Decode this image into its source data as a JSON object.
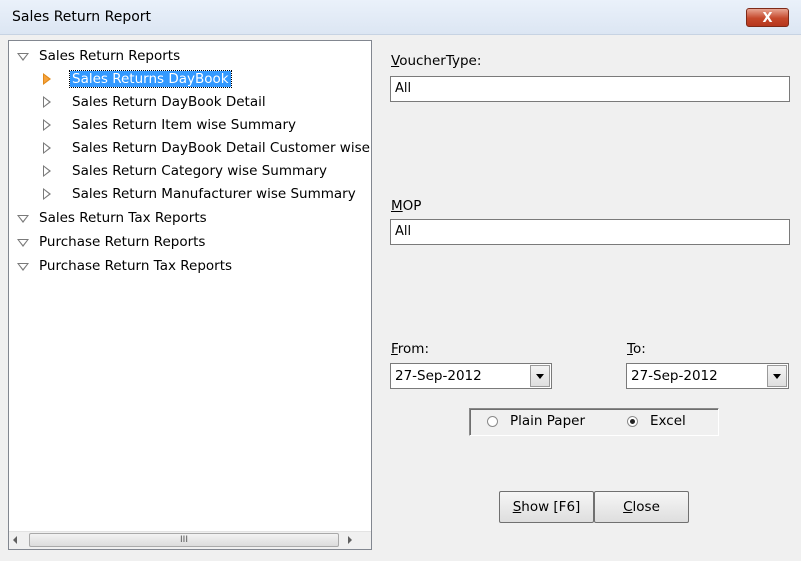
{
  "window": {
    "title": "Sales Return Report",
    "close_glyph": "X"
  },
  "tree": [
    {
      "label": "Sales Return Reports",
      "expanded": true,
      "children": [
        {
          "label": "Sales Returns DayBook",
          "selected": true
        },
        {
          "label": "Sales Return DayBook Detail"
        },
        {
          "label": "Sales Return Item wise Summary"
        },
        {
          "label": "Sales Return DayBook Detail Customer wise"
        },
        {
          "label": "Sales Return Category wise Summary"
        },
        {
          "label": "Sales Return Manufacturer wise Summary"
        }
      ]
    },
    {
      "label": "Sales Return Tax Reports",
      "expanded": true
    },
    {
      "label": "Purchase Return Reports",
      "expanded": true
    },
    {
      "label": "Purchase Return Tax Reports",
      "expanded": true
    }
  ],
  "scrollbar": {
    "thumb_grip": "III"
  },
  "form": {
    "voucher_type": {
      "label_underlined": "V",
      "label_rest": "oucherType:",
      "value": "All"
    },
    "mop": {
      "label_underlined": "M",
      "label_rest": "OP",
      "value": "All"
    },
    "from": {
      "label_underlined": "F",
      "label_rest": "rom:",
      "value": "27-Sep-2012"
    },
    "to": {
      "label_underlined": "T",
      "label_rest": "o:",
      "value": "27-Sep-2012"
    },
    "output": {
      "options": [
        "Plain Paper",
        "Excel"
      ],
      "selected": "Excel"
    }
  },
  "buttons": {
    "show": {
      "underlined": "S",
      "rest": "how [F6]"
    },
    "close": {
      "underlined": "C",
      "rest": "lose"
    }
  }
}
